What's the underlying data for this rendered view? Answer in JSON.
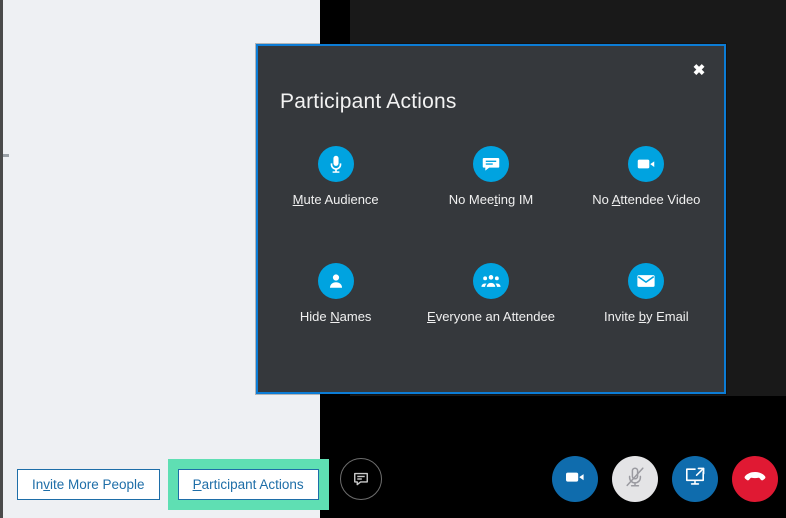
{
  "colors": {
    "accent_blue": "#00a3e0",
    "dialog_border": "#0c7cd5",
    "dialog_bg": "#35383c",
    "panel_bg": "#eef0f3",
    "highlight_green": "#5fdfb3",
    "button_blue": "#1e6ea8",
    "call_blue": "#0f6cad",
    "hangup_red": "#e01933"
  },
  "roster": {
    "invite_more_people": {
      "label_before": "In",
      "accesskey": "v",
      "label_after": "ite More People",
      "icon": "invite-more-people-button"
    },
    "participant_actions": {
      "label_before": "",
      "accesskey": "P",
      "label_after": "articipant Actions",
      "icon": "participant-actions-button",
      "highlighted": true
    }
  },
  "dialog": {
    "title": "Participant Actions",
    "close_label": "✖",
    "close_icon": "close-icon",
    "actions": [
      {
        "label_before": "",
        "accesskey": "M",
        "label_after": "ute Audience",
        "full_label": "Mute Audience",
        "icon": "microphone-icon"
      },
      {
        "label_before": "No Mee",
        "accesskey": "t",
        "label_after": "ing IM",
        "full_label": "No Meeting IM",
        "icon": "chat-bubble-icon"
      },
      {
        "label_before": "No ",
        "accesskey": "A",
        "label_after": "ttendee Video",
        "full_label": "No Attendee Video",
        "icon": "video-camera-icon"
      },
      {
        "label_before": "Hide ",
        "accesskey": "N",
        "label_after": "ames",
        "full_label": "Hide Names",
        "icon": "person-icon"
      },
      {
        "label_before": "",
        "accesskey": "E",
        "label_after": "veryone an Attendee",
        "full_label": "Everyone an Attendee",
        "icon": "people-group-icon"
      },
      {
        "label_before": "Invite ",
        "accesskey": "b",
        "label_after": "y Email",
        "full_label": "Invite by Email",
        "icon": "envelope-icon"
      }
    ]
  },
  "call_bar": {
    "im_button": {
      "icon": "im-chat-icon"
    },
    "controls": [
      {
        "icon": "video-camera-icon",
        "name": "video-button",
        "state": "on"
      },
      {
        "icon": "microphone-muted-icon",
        "name": "mute-button",
        "state": "muted"
      },
      {
        "icon": "present-screen-icon",
        "name": "present-button",
        "state": "on"
      },
      {
        "icon": "hangup-phone-icon",
        "name": "hangup-button",
        "state": "active"
      }
    ]
  }
}
